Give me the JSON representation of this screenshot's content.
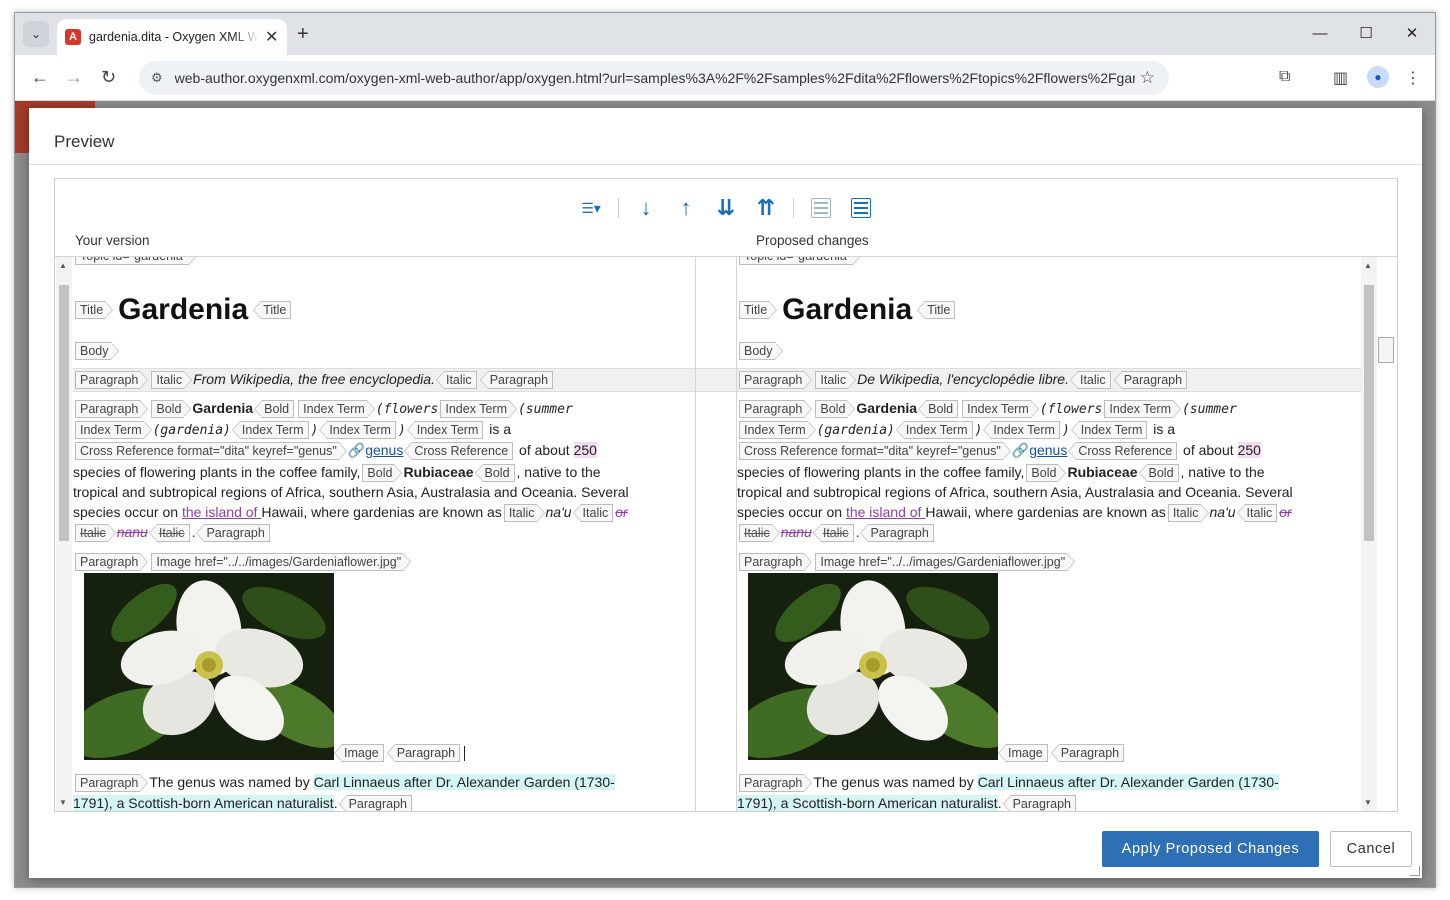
{
  "browser": {
    "tab_title": "gardenia.dita - Oxygen XML Web Author",
    "url": "web-author.oxygenxml.com/oxygen-xml-web-author/app/oxygen.html?url=samples%3A%2F%2Fsamples%2Fdita%2Fflowers%2Ftopics%2Fflowers%2Fgar..."
  },
  "dialog": {
    "title": "Preview",
    "left_label": "Your version",
    "right_label": "Proposed changes",
    "apply_label": "Apply Proposed Changes",
    "cancel_label": "Cancel"
  },
  "tags": {
    "topic": "Topic id=\"gardenia\"",
    "title": "Title",
    "body": "Body",
    "paragraph": "Paragraph",
    "italic": "Italic",
    "bold": "Bold",
    "index_term": "Index Term",
    "xref": "Cross Reference format=\"dita\" keyref=\"genus\"",
    "xref_close": "Cross Reference",
    "image": "Image",
    "image_open": "Image href=\"../../images/Gardeniaflower.jpg\""
  },
  "left": {
    "title": "Gardenia",
    "intro": "From Wikipedia, the free encyclopedia.",
    "intro_pre": "From Wikipedia, ",
    "intro_hl1": "the",
    "intro_mid": " free ",
    "intro_hl2": "encyclopedia",
    "intro_end": "."
  },
  "right": {
    "title": "Gardenia",
    "intro_pre": "De Wikipedia, ",
    "intro_hl1": "l'encyclopédie",
    "intro_mid": " ",
    "intro_hl2": "libre",
    "intro_end": "."
  },
  "para": {
    "gardenia": "Gardenia",
    "flowers": "(flowers",
    "summer": "(summer",
    "gardenia_mono": "(gardenia)",
    "paren_close": ")",
    "is_a": "is a",
    "genus": "genus",
    "of_about": "of about",
    "num": "250",
    "line3": "species of flowering plants in the coffee family,",
    "rubiaceae": "Rubiaceae",
    "line3_end": ", native to the",
    "line4": "tropical and subtropical regions of Africa, southern Asia, Australasia and Oceania. Several",
    "line5_pre": "species occur on ",
    "island": "the island of ",
    "line5_mid": "Hawaii, where gardenias are known as",
    "nau": "na'u",
    "or": "or",
    "nanu": "nanu",
    "dot": ".",
    "genus_named": "The genus was named by",
    "linnaeus": "Carl Linnaeus after Dr. Alexander Garden (1730-",
    "linnaeus2": "1791), a Scottish-born American naturalist",
    "period": "."
  },
  "colors": {
    "primary_button": "#2f6fb5",
    "insertion": "#8e3fa8",
    "change_bg": "#f3dcf2",
    "highlight_cyan": "#d5f4f4"
  }
}
